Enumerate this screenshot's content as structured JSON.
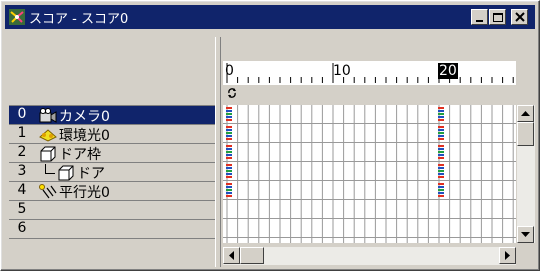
{
  "window": {
    "title": "スコア - スコア0",
    "icon": "score-app-icon",
    "controls": [
      "minimize-icon",
      "maximize-icon",
      "close-icon"
    ]
  },
  "timeline": {
    "ruler_labels": [
      "0",
      "10",
      "20"
    ],
    "current_frame": "20",
    "loop_icon": "loop-arrows-icon"
  },
  "tracks": [
    {
      "num": "0",
      "label": "カメラ0",
      "icon": "camera-icon",
      "selected": true
    },
    {
      "num": "1",
      "label": "環境光0",
      "icon": "ambient-light-icon",
      "selected": false
    },
    {
      "num": "2",
      "label": "ドア枠",
      "icon": "box-object-icon",
      "selected": false
    },
    {
      "num": "3",
      "label": "ドア",
      "icon": "box-object-icon",
      "selected": false
    },
    {
      "num": "4",
      "label": "平行光0",
      "icon": "directional-light-icon",
      "selected": false
    },
    {
      "num": "5",
      "label": "",
      "icon": "",
      "selected": false
    },
    {
      "num": "6",
      "label": "",
      "icon": "",
      "selected": false
    }
  ],
  "colors": {
    "titlebar": "#10246b",
    "selection": "#10246b",
    "face": "#d4d0c8",
    "keyframe_red": "#e03020",
    "keyframe_blue": "#2050c0",
    "keyframe_green": "#20a040"
  }
}
